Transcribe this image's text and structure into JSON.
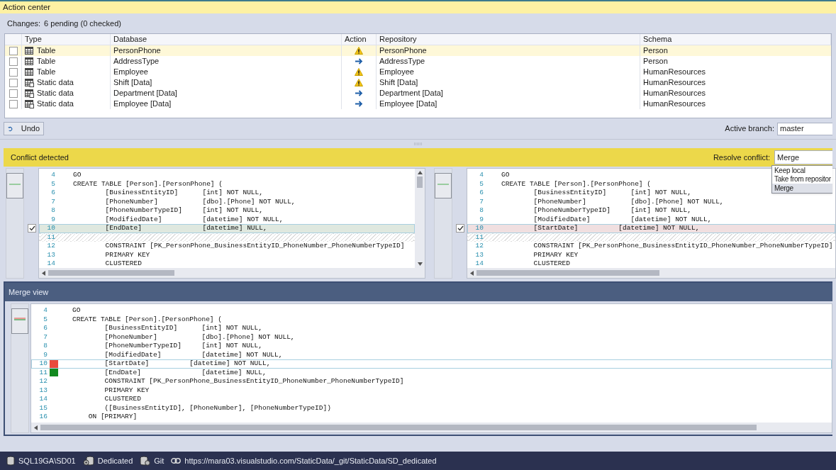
{
  "window": {
    "title": "Action center"
  },
  "changes": {
    "label": "Changes:",
    "summary": "6 pending (0 checked)"
  },
  "table": {
    "columns": [
      "Type",
      "Database",
      "Action",
      "Repository",
      "Schema"
    ],
    "rows": [
      {
        "checked": false,
        "selected": true,
        "kind": "table",
        "type": "Table",
        "database": "PersonPhone",
        "warning": true,
        "repository": "PersonPhone",
        "schema": "Person"
      },
      {
        "checked": false,
        "selected": false,
        "kind": "table",
        "type": "Table",
        "database": "AddressType",
        "warning": false,
        "repository": "AddressType",
        "schema": "Person"
      },
      {
        "checked": false,
        "selected": false,
        "kind": "table",
        "type": "Table",
        "database": "Employee",
        "warning": true,
        "repository": "Employee",
        "schema": "HumanResources"
      },
      {
        "checked": false,
        "selected": false,
        "kind": "static",
        "type": "Static data",
        "database": "Shift [Data]",
        "warning": true,
        "repository": "Shift [Data]",
        "schema": "HumanResources"
      },
      {
        "checked": false,
        "selected": false,
        "kind": "static",
        "type": "Static data",
        "database": "Department [Data]",
        "warning": false,
        "repository": "Department [Data]",
        "schema": "HumanResources"
      },
      {
        "checked": false,
        "selected": false,
        "kind": "static",
        "type": "Static data",
        "database": "Employee [Data]",
        "warning": false,
        "repository": "Employee [Data]",
        "schema": "HumanResources"
      }
    ]
  },
  "undo_button": "Undo",
  "active_branch": {
    "label": "Active branch:",
    "value": "master"
  },
  "conflict": {
    "title": "Conflict detected",
    "resolve_label": "Resolve conflict:",
    "resolve_value": "Merge",
    "options": [
      {
        "label": "Keep local",
        "selected": false
      },
      {
        "label": "Take from repositor",
        "selected": false
      },
      {
        "label": "Merge",
        "selected": true
      }
    ],
    "local": [
      {
        "n": "4",
        "kind": "normal",
        "text": "GO"
      },
      {
        "n": "5",
        "kind": "normal",
        "text": "CREATE TABLE [Person].[PersonPhone] ("
      },
      {
        "n": "6",
        "kind": "normal",
        "text": "        [BusinessEntityID]      [int] NOT NULL,"
      },
      {
        "n": "7",
        "kind": "normal",
        "text": "        [PhoneNumber]           [dbo].[Phone] NOT NULL,"
      },
      {
        "n": "8",
        "kind": "normal",
        "text": "        [PhoneNumberTypeID]     [int] NOT NULL,"
      },
      {
        "n": "9",
        "kind": "normal",
        "text": "        [ModifiedDate]          [datetime] NOT NULL,"
      },
      {
        "n": "10",
        "kind": "added",
        "checked": true,
        "text": "        [EndDate]               [datetime] NULL,"
      },
      {
        "n": "11",
        "kind": "gap"
      },
      {
        "n": "12",
        "kind": "normal",
        "text": "        CONSTRAINT [PK_PersonPhone_BusinessEntityID_PhoneNumber_PhoneNumberTypeID]"
      },
      {
        "n": "13",
        "kind": "normal",
        "text": "        PRIMARY KEY"
      },
      {
        "n": "14",
        "kind": "normal",
        "text": "        CLUSTERED"
      }
    ],
    "repository": [
      {
        "n": "4",
        "kind": "normal",
        "text": "GO"
      },
      {
        "n": "5",
        "kind": "normal",
        "text": "CREATE TABLE [Person].[PersonPhone] ("
      },
      {
        "n": "6",
        "kind": "normal",
        "text": "        [BusinessEntityID]      [int] NOT NULL,"
      },
      {
        "n": "7",
        "kind": "normal",
        "text": "        [PhoneNumber]           [dbo].[Phone] NOT NULL,"
      },
      {
        "n": "8",
        "kind": "normal",
        "text": "        [PhoneNumberTypeID]     [int] NOT NULL,"
      },
      {
        "n": "9",
        "kind": "normal",
        "text": "        [ModifiedDate]          [datetime] NOT NULL,"
      },
      {
        "n": "10",
        "kind": "removed",
        "checked": true,
        "text": "        [StartDate]          [datetime] NOT NULL,"
      },
      {
        "n": "11",
        "kind": "gap"
      },
      {
        "n": "12",
        "kind": "normal",
        "text": "        CONSTRAINT [PK_PersonPhone_BusinessEntityID_PhoneNumber_PhoneNumberTypeID]"
      },
      {
        "n": "13",
        "kind": "normal",
        "text": "        PRIMARY KEY"
      },
      {
        "n": "14",
        "kind": "normal",
        "text": "        CLUSTERED"
      }
    ]
  },
  "merge_view": {
    "title": "Merge view",
    "lines": [
      {
        "n": "4",
        "kind": "normal",
        "text": "GO"
      },
      {
        "n": "5",
        "kind": "normal",
        "text": "CREATE TABLE [Person].[PersonPhone] ("
      },
      {
        "n": "6",
        "kind": "normal",
        "text": "        [BusinessEntityID]      [int] NOT NULL,"
      },
      {
        "n": "7",
        "kind": "normal",
        "text": "        [PhoneNumber]           [dbo].[Phone] NOT NULL,"
      },
      {
        "n": "8",
        "kind": "normal",
        "text": "        [PhoneNumberTypeID]     [int] NOT NULL,"
      },
      {
        "n": "9",
        "kind": "normal",
        "text": "        [ModifiedDate]          [datetime] NOT NULL,"
      },
      {
        "n": "10",
        "kind": "removed",
        "text": "        [StartDate]          [datetime] NOT NULL,"
      },
      {
        "n": "11",
        "kind": "added",
        "text": "        [EndDate]               [datetime] NULL,"
      },
      {
        "n": "12",
        "kind": "normal",
        "text": "        CONSTRAINT [PK_PersonPhone_BusinessEntityID_PhoneNumber_PhoneNumberTypeID]"
      },
      {
        "n": "13",
        "kind": "normal",
        "text": "        PRIMARY KEY"
      },
      {
        "n": "14",
        "kind": "normal",
        "text": "        CLUSTERED"
      },
      {
        "n": "15",
        "kind": "normal",
        "text": "        ([BusinessEntityID], [PhoneNumber], [PhoneNumberTypeID])"
      },
      {
        "n": "16",
        "kind": "normal",
        "text": "    ON [PRIMARY]"
      }
    ]
  },
  "status_bar": [
    {
      "kind": "server",
      "text": "SQL19GA\\SD01"
    },
    {
      "kind": "mode",
      "text": "Dedicated"
    },
    {
      "kind": "vcs",
      "text": "Git"
    },
    {
      "kind": "link",
      "text": "https://mara03.visualstudio.com/StaticData/_git/StaticData/SD_dedicated"
    }
  ]
}
